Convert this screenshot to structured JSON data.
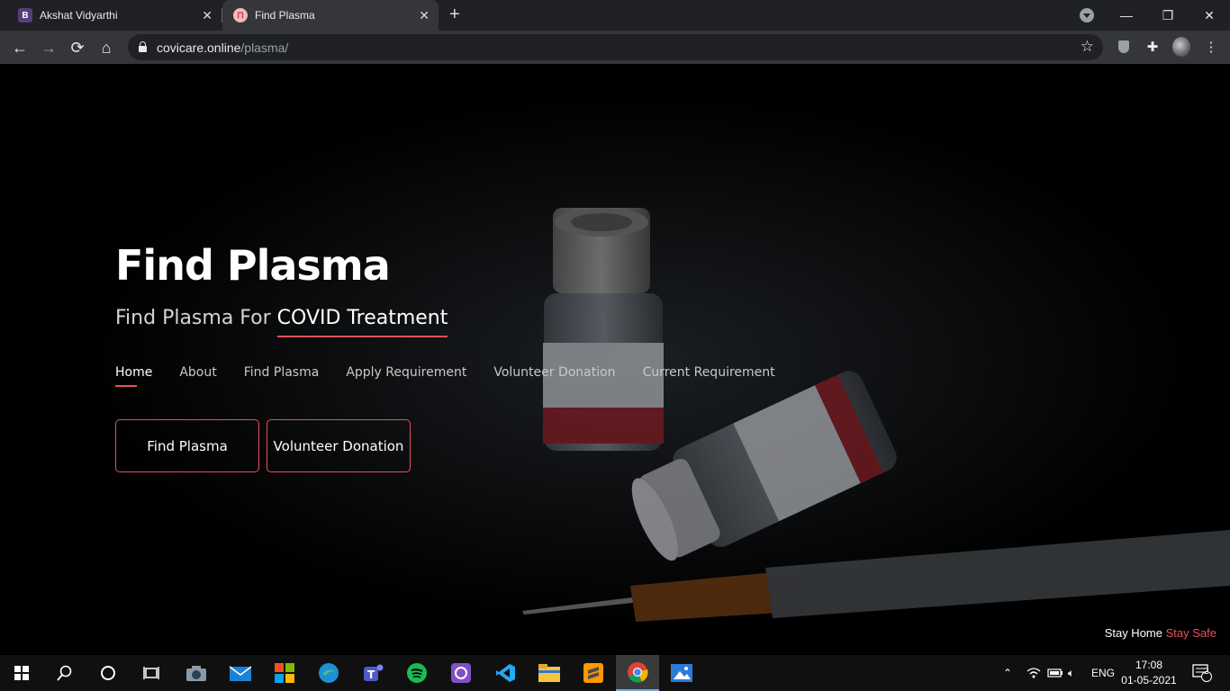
{
  "browser": {
    "tabs": [
      {
        "title": "Akshat Vidyarthi",
        "favicon": "B",
        "active": false
      },
      {
        "title": "Find Plasma",
        "favicon": "pink-logo",
        "active": true
      }
    ],
    "new_tab": "+",
    "url_host": "covicare.online",
    "url_path": "/plasma/",
    "window_controls": {
      "minimize": "—",
      "restore": "❐",
      "close": "✕"
    }
  },
  "hero": {
    "title": "Find Plasma",
    "subtitle_prefix": "Find Plasma For ",
    "subtitle_highlight": "COVID Treatment",
    "nav": [
      "Home",
      "About",
      "Find Plasma",
      "Apply Requirement",
      "Volunteer Donation",
      "Current Requirement"
    ],
    "buttons": {
      "primary": "Find Plasma",
      "secondary": "Volunteer Donation"
    },
    "footer_left": "Stay Home",
    "footer_right": "Stay Safe",
    "accent_color": "#e8505b"
  },
  "taskbar": {
    "language": "ENG",
    "time": "17:08",
    "date": "01-05-2021",
    "notifications": "2"
  }
}
